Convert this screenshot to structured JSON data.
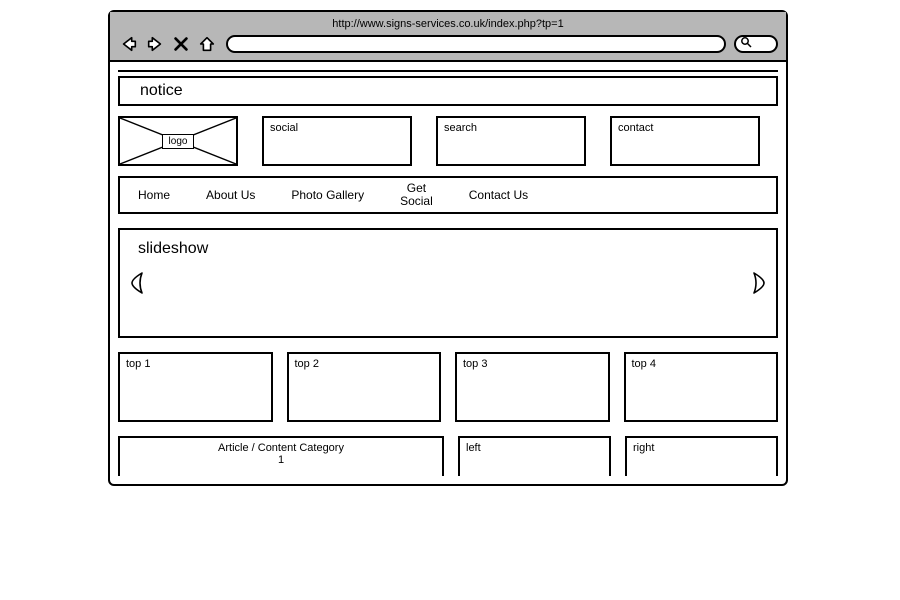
{
  "browser": {
    "url": "http://www.signs-services.co.uk/index.php?tp=1"
  },
  "notice": "notice",
  "header": {
    "logo_label": "logo",
    "social": "social",
    "search": "search",
    "contact": "contact"
  },
  "nav": {
    "home": "Home",
    "about": "About Us",
    "gallery": "Photo Gallery",
    "getsocial": "Get\nSocial",
    "contact": "Contact Us"
  },
  "slideshow": {
    "label": "slideshow"
  },
  "top_boxes": {
    "b1": "top 1",
    "b2": "top 2",
    "b3": "top 3",
    "b4": "top 4"
  },
  "bottom": {
    "article": "Article / Content Category\n1",
    "left": "left",
    "right": "right"
  }
}
